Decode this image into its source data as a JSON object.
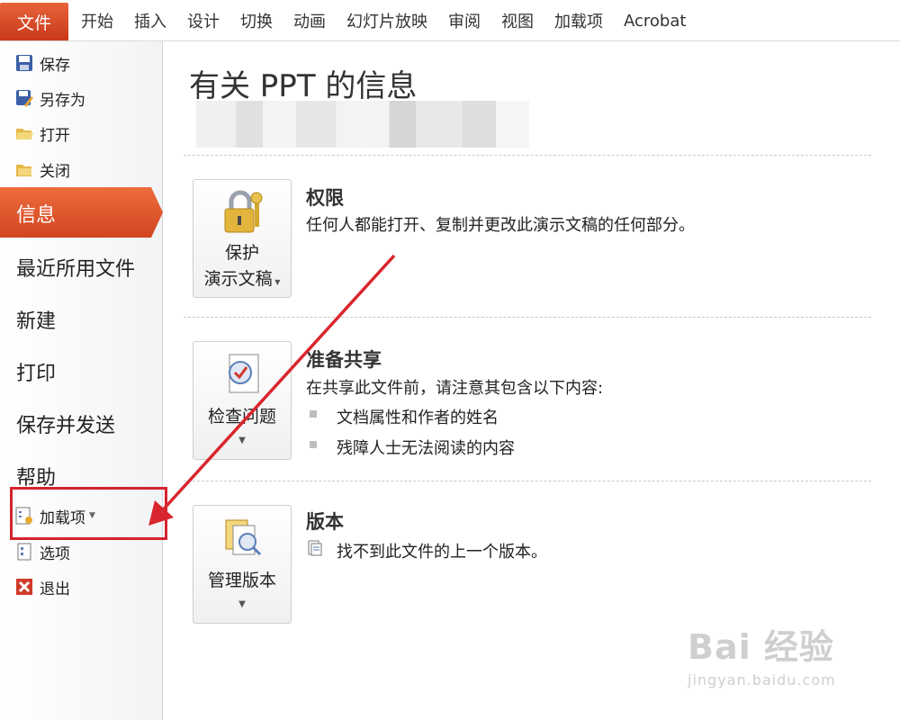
{
  "ribbon": {
    "file_tab": "文件",
    "tabs": [
      "开始",
      "插入",
      "设计",
      "切换",
      "动画",
      "幻灯片放映",
      "审阅",
      "视图",
      "加载项",
      "Acrobat"
    ]
  },
  "leftnav": {
    "save": "保存",
    "save_as": "另存为",
    "open": "打开",
    "close": "关闭",
    "info": "信息",
    "recent": "最近所用文件",
    "new": "新建",
    "print": "打印",
    "save_send": "保存并发送",
    "help": "帮助",
    "addins": "加载项",
    "options": "选项",
    "exit": "退出"
  },
  "main": {
    "title": "有关 PPT 的信息",
    "permissions": {
      "button_line1": "保护",
      "button_line2": "演示文稿",
      "title": "权限",
      "text": "任何人都能打开、复制并更改此演示文稿的任何部分。"
    },
    "prepare": {
      "button": "检查问题",
      "title": "准备共享",
      "text": "在共享此文件前，请注意其包含以下内容:",
      "bullets": [
        "文档属性和作者的姓名",
        "残障人士无法阅读的内容"
      ]
    },
    "versions": {
      "button": "管理版本",
      "title": "版本",
      "text": "找不到此文件的上一个版本。"
    }
  },
  "watermark": {
    "brand": "Bai 经验",
    "url": "jingyan.baidu.com"
  },
  "colors": {
    "file_tab": "#d2451f",
    "highlight_box": "#d4232e",
    "arrow": "#d9262e"
  }
}
